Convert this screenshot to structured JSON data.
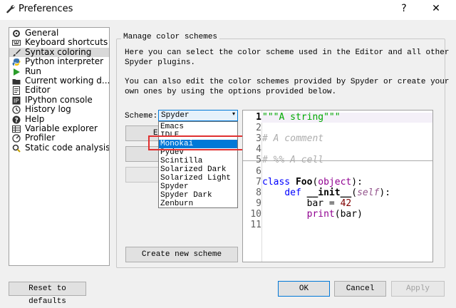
{
  "window": {
    "title": "Preferences",
    "help_glyph": "?",
    "close_glyph": "✕"
  },
  "sidebar": {
    "items": [
      {
        "label": "General",
        "icon": "gears-icon"
      },
      {
        "label": "Keyboard shortcuts",
        "icon": "keyboard-icon"
      },
      {
        "label": "Syntax coloring",
        "icon": "brush-icon"
      },
      {
        "label": "Python interpreter",
        "icon": "python-icon"
      },
      {
        "label": "Run",
        "icon": "run-icon"
      },
      {
        "label": "Current working d...",
        "icon": "folder-icon"
      },
      {
        "label": "Editor",
        "icon": "editor-icon"
      },
      {
        "label": "IPython console",
        "icon": "ipython-icon"
      },
      {
        "label": "History log",
        "icon": "history-icon"
      },
      {
        "label": "Help",
        "icon": "help-icon"
      },
      {
        "label": "Variable explorer",
        "icon": "table-icon"
      },
      {
        "label": "Profiler",
        "icon": "profiler-icon"
      },
      {
        "label": "Static code analysis",
        "icon": "magnifier-icon"
      }
    ],
    "selected_index": 2
  },
  "panel": {
    "group_title": "Manage color schemes",
    "desc1_line1": "Here you can select the color scheme used in the Editor and all other",
    "desc1_line2": "Spyder plugins.",
    "desc2_line1": "You can also edit the color schemes provided by Spyder or create your",
    "desc2_line2": "own ones by using the options provided below.",
    "scheme_label": "Scheme:",
    "scheme_value": "Spyder",
    "dropdown_options": [
      "Emacs",
      "IDLE",
      "Monokai",
      "Pydev",
      "Scintilla",
      "Solarized Dark",
      "Solarized Light",
      "Spyder",
      "Spyder Dark",
      "Zenburn"
    ],
    "dropdown_highlighted": "Monokai",
    "partial_button_text": "E",
    "create_button": "Create new scheme"
  },
  "preview": {
    "lines": [
      {
        "num": "1",
        "text": "\"\"\"A string\"\"\""
      },
      {
        "num": "2",
        "text": ""
      },
      {
        "num": "3",
        "text": "# A comment"
      },
      {
        "num": "4",
        "text": ""
      },
      {
        "num": "5",
        "text": "# %% A cell"
      },
      {
        "num": "6",
        "text": ""
      },
      {
        "num": "7",
        "text": "class Foo(object):"
      },
      {
        "num": "8",
        "text": "    def __init__(self):"
      },
      {
        "num": "9",
        "text": "        bar = 42"
      },
      {
        "num": "10",
        "text": "        print(bar)"
      },
      {
        "num": "11",
        "text": ""
      }
    ],
    "colors": {
      "string": "#00aa00",
      "comment": "#adadad",
      "keyword": "#0000ff",
      "number": "#800000",
      "builtin": "#900090",
      "self": "#94558d"
    }
  },
  "footer": {
    "reset": "Reset to defaults",
    "ok": "OK",
    "cancel": "Cancel",
    "apply": "Apply"
  }
}
